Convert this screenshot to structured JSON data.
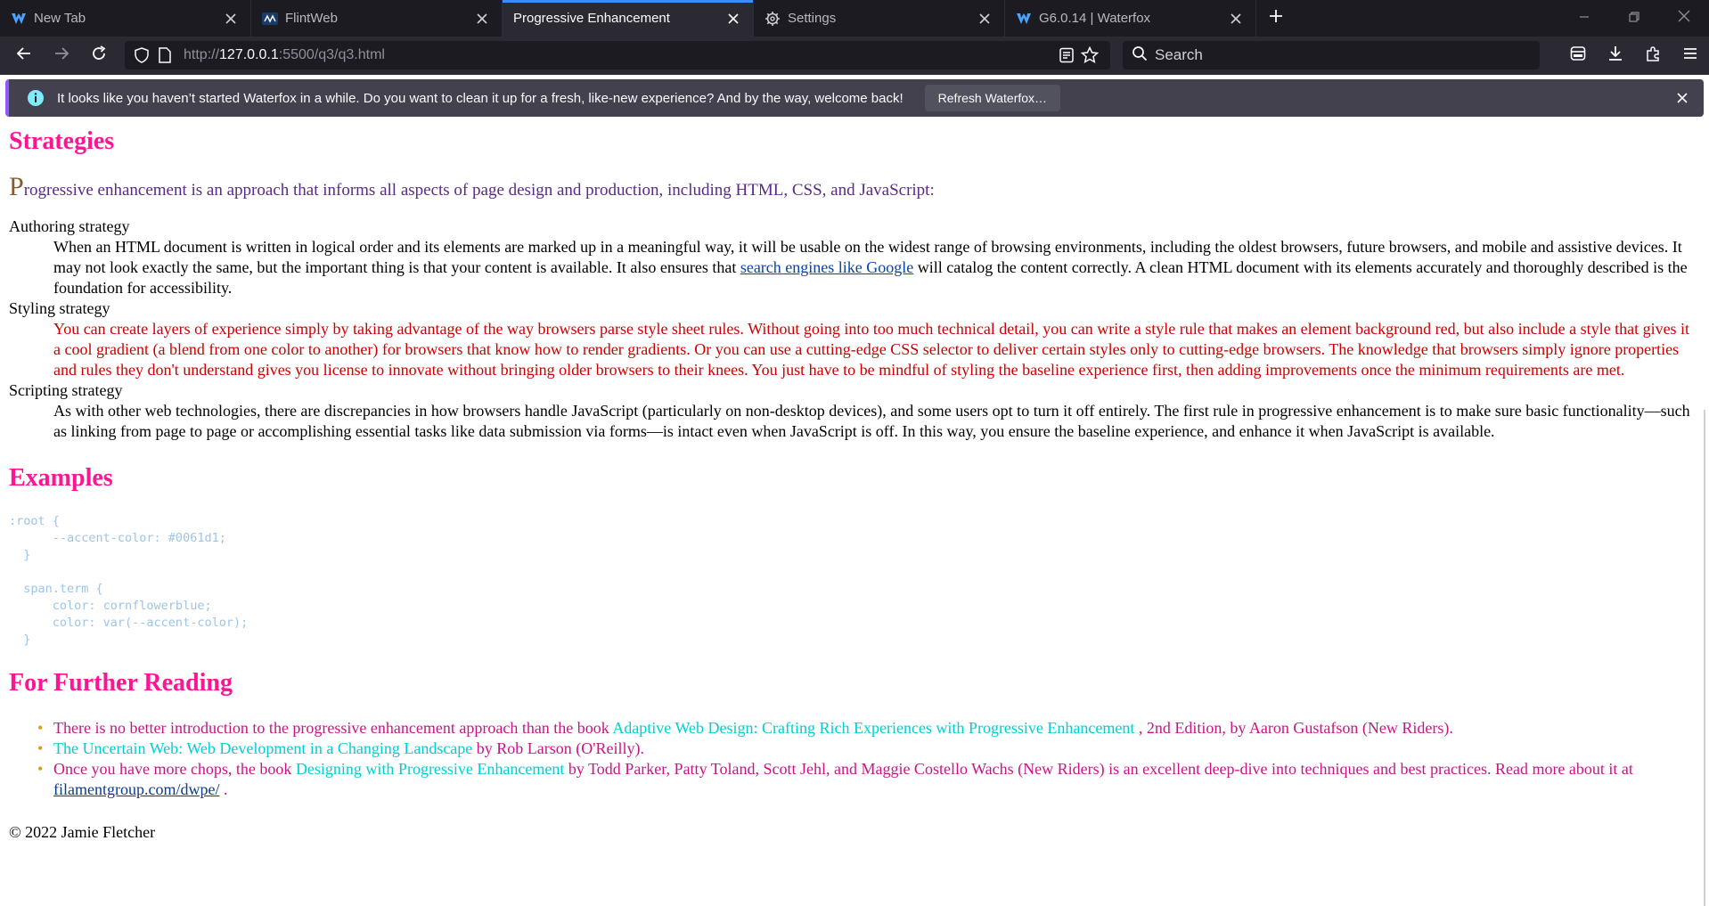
{
  "browser": {
    "tabs": [
      {
        "title": "New Tab",
        "favicon": "waterfox-icon",
        "active": false
      },
      {
        "title": "FlintWeb",
        "favicon": "flintweb-icon",
        "active": false
      },
      {
        "title": "Progressive Enhancement",
        "favicon": "",
        "active": true
      },
      {
        "title": "Settings",
        "favicon": "gear-icon",
        "active": false
      },
      {
        "title": "G6.0.14 | Waterfox",
        "favicon": "waterfox-icon",
        "active": false
      }
    ],
    "url_prefix": "http://",
    "url_host": "127.0.0.1",
    "url_rest": ":5500/q3/q3.html",
    "search_placeholder": "Search",
    "accent": "#3d8bff"
  },
  "notification": {
    "message": "It looks like you haven’t started Waterfox in a while. Do you want to clean it up for a fresh, like-new experience? And by the way, welcome back!",
    "button": "Refresh Waterfox…"
  },
  "page": {
    "strategies_heading": "Strategies",
    "intro_drop": "P",
    "intro_rest": "rogressive enhancement is an approach that informs all aspects of page design and production, including HTML, CSS, and JavaScript:",
    "authoring_term": "Authoring strategy",
    "authoring_a": "When an HTML document is written in logical order and its elements are marked up in a meaningful way, it will be usable on the widest range of browsing environments, including the oldest browsers, future browsers, and mobile and assistive devices. It may not look exactly the same, but the important thing is that your content is available. It also ensures that ",
    "authoring_link": "search engines like Google",
    "authoring_b": " will catalog the content correctly. A clean HTML document with its elements accurately and thoroughly described is the foundation for accessibility.",
    "styling_term": "Styling strategy",
    "styling_text": "You can create layers of experience simply by taking advantage of the way browsers parse style sheet rules. Without going into too much technical detail, you can write a style rule that makes an element background red, but also include a style that gives it a cool gradient (a blend from one color to another) for browsers that know how to render gradients. Or you can use a cutting-edge CSS selector to deliver certain styles only to cutting-edge browsers. The knowledge that browsers simply ignore properties and rules they don't understand gives you license to innovate without bringing older browsers to their knees. You just have to be mindful of styling the baseline experience first, then adding improvements once the minimum requirements are met.",
    "scripting_term": "Scripting strategy",
    "scripting_text": "As with other web technologies, there are discrepancies in how browsers handle JavaScript (particularly on non-desktop devices), and some users opt to turn it off entirely. The first rule in progressive enhancement is to make sure basic functionality—such as linking from page to page or accomplishing essential tasks like data submission via forms—is intact even when JavaScript is off. In this way, you ensure the baseline experience, and enhance it when JavaScript is available.",
    "examples_heading": "Examples",
    "code": ":root {\n      --accent-color: #0061d1;\n  }\n\n  span.term {\n      color: cornflowerblue;\n      color: var(--accent-color);\n  }",
    "reading_heading": "For Further Reading",
    "reading1_a": "There is no better introduction to the progressive enhancement approach than the book ",
    "reading1_book": "Adaptive Web Design: Crafting Rich Experiences with Progressive Enhancement",
    "reading1_b": " , 2nd Edition, by Aaron Gustafson (New Riders).",
    "reading2_book": "The Uncertain Web: Web Development in a Changing Landscape",
    "reading2_b": " by Rob Larson (O'Reilly).",
    "reading3_a": "Once you have more chops, the book ",
    "reading3_book": "Designing with Progressive Enhancement",
    "reading3_b": " by Todd Parker, Patty Toland, Scott Jehl, and Maggie Costello Wachs (New Riders) is an excellent deep-dive into techniques and best practices. Read more about it at ",
    "reading3_link": "filamentgroup.com/dwpe/",
    "reading3_c": " .",
    "footer": "© 2022 Jamie Fletcher"
  }
}
